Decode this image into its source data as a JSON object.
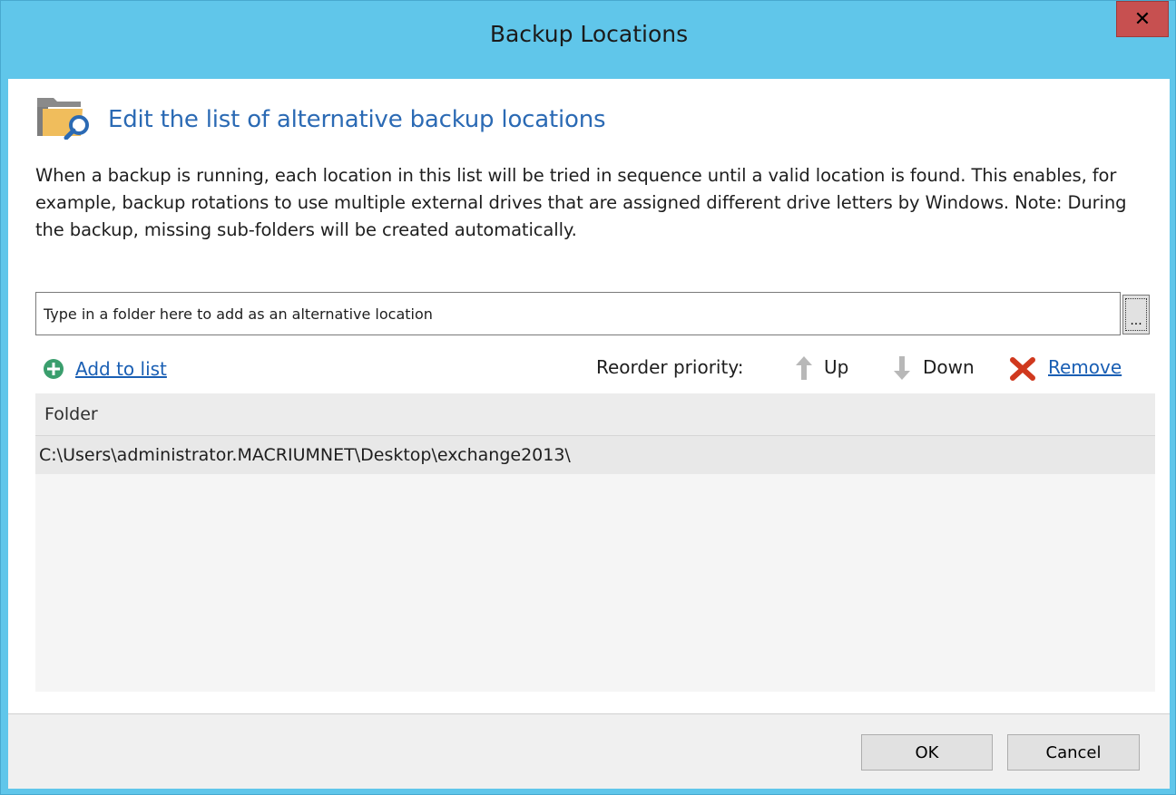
{
  "window": {
    "title": "Backup Locations"
  },
  "header": {
    "heading": "Edit the list of alternative backup locations"
  },
  "description": "When a backup is running, each location in this list will be tried in sequence until a valid location is found. This enables, for example, backup rotations to use multiple external drives that are assigned different drive letters by Windows.   Note: During the backup, missing sub-folders will be created automatically.",
  "folder_input": {
    "value": "",
    "placeholder": "Type in a folder here to add as an alternative location",
    "browse_label": "..."
  },
  "toolbar": {
    "add_label": "Add to list",
    "reorder_label": "Reorder priority:",
    "up_label": "Up",
    "down_label": "Down",
    "remove_label": "Remove"
  },
  "list": {
    "column_header": "Folder",
    "rows": [
      "C:\\Users\\administrator.MACRIUMNET\\Desktop\\exchange2013\\"
    ]
  },
  "footer": {
    "ok_label": "OK",
    "cancel_label": "Cancel"
  },
  "icons": {
    "folder_search": "folder-search-icon",
    "add": "plus-circle-icon",
    "up": "arrow-up-icon",
    "down": "arrow-down-icon",
    "remove": "x-icon",
    "close": "close-icon"
  },
  "colors": {
    "title_bar": "#60c6ea",
    "heading": "#2b6ab4",
    "link": "#1a5fb4",
    "add_icon": "#3a9e6d",
    "remove_icon": "#d0391e",
    "arrow_icon": "#b8b8b8",
    "close_button": "#c75050"
  }
}
